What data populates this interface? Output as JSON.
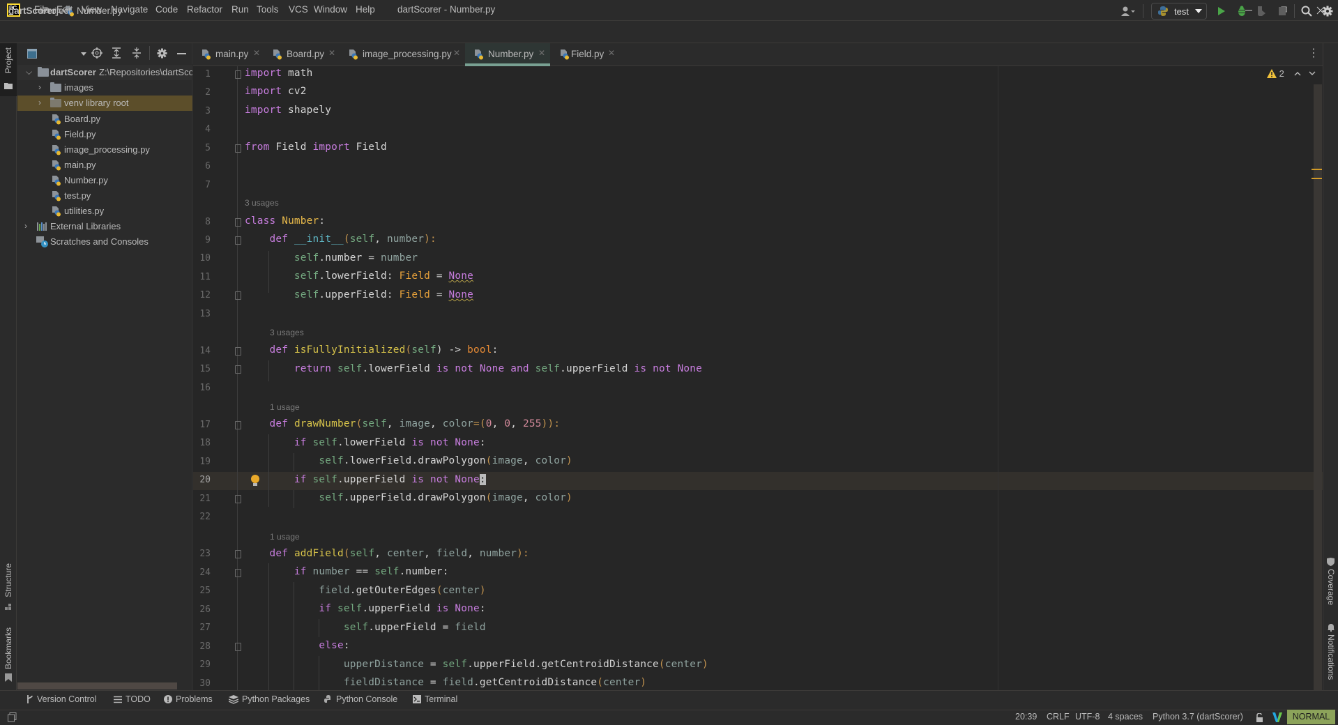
{
  "titlebar": {
    "logo_text": "PC",
    "menu": [
      "File",
      "Edit",
      "View",
      "Navigate",
      "Code",
      "Refactor",
      "Run",
      "Tools",
      "VCS",
      "Window",
      "Help"
    ],
    "window_title": "dartScorer - Number.py"
  },
  "navbar": {
    "breadcrumb_project": "dartScorer",
    "breadcrumb_file": "Number.py",
    "run_config": "test"
  },
  "left_strip": {
    "project": "Project",
    "structure": "Structure",
    "bookmarks": "Bookmarks"
  },
  "right_strip": {
    "coverage": "Coverage",
    "notifications": "Notifications"
  },
  "project_panel": {
    "title": "Project",
    "root_name": "dartScorer",
    "root_path": "Z:\\Repositories\\dartScorer",
    "items": [
      {
        "label": "images",
        "type": "folder"
      },
      {
        "label": "venv  library root",
        "type": "folder"
      },
      {
        "label": "Board.py",
        "type": "python"
      },
      {
        "label": "Field.py",
        "type": "python"
      },
      {
        "label": "image_processing.py",
        "type": "python"
      },
      {
        "label": "main.py",
        "type": "python"
      },
      {
        "label": "Number.py",
        "type": "python"
      },
      {
        "label": "test.py",
        "type": "python"
      },
      {
        "label": "utilities.py",
        "type": "python"
      }
    ],
    "external_libraries": "External Libraries",
    "scratches": "Scratches and Consoles"
  },
  "tabs": [
    {
      "label": "main.py",
      "active": false
    },
    {
      "label": "Board.py",
      "active": false
    },
    {
      "label": "image_processing.py",
      "active": false
    },
    {
      "label": "Number.py",
      "active": true
    },
    {
      "label": "Field.py",
      "active": false
    }
  ],
  "editor": {
    "warnings_count": "2",
    "usage_hints": [
      "3 usages",
      "3 usages",
      "1 usage",
      "1 usage"
    ],
    "line_numbers": [
      "1",
      "2",
      "3",
      "4",
      "5",
      "6",
      "7",
      "8",
      "9",
      "10",
      "11",
      "12",
      "13",
      "14",
      "15",
      "16",
      "17",
      "18",
      "19",
      "20",
      "21",
      "22",
      "23",
      "24",
      "25",
      "26",
      "27",
      "28",
      "29",
      "30"
    ],
    "current_line": "20",
    "lines": {
      "l1": [
        "import",
        " math"
      ],
      "l2": [
        "import",
        " cv2"
      ],
      "l3": [
        "import",
        " shapely"
      ],
      "l5": [
        "from",
        " Field ",
        "import",
        " Field"
      ],
      "l8": [
        "class",
        " ",
        "Number",
        ":"
      ],
      "l9": [
        "    ",
        "def",
        " ",
        "__init__",
        "(",
        "self",
        ", ",
        "number",
        "):"
      ],
      "l10": [
        "        ",
        "self",
        ".number = ",
        "number"
      ],
      "l11": [
        "        ",
        "self",
        ".lowerField: ",
        "Field",
        " = ",
        "None"
      ],
      "l12": [
        "        ",
        "self",
        ".upperField: ",
        "Field",
        " = ",
        "None"
      ],
      "l14": [
        "    ",
        "def",
        " ",
        "isFullyInitialized",
        "(",
        "self",
        ") -> ",
        "bool",
        ":"
      ],
      "l15": [
        "        ",
        "return",
        " ",
        "self",
        ".lowerField ",
        "is not None and",
        " ",
        "self",
        ".upperField ",
        "is not None"
      ],
      "l17": [
        "    ",
        "def",
        " ",
        "drawNumber",
        "(",
        "self",
        ", ",
        "image",
        ", ",
        "color",
        "=(",
        "0",
        ", ",
        "0",
        ", ",
        "255",
        ")):"
      ],
      "l18": [
        "        ",
        "if",
        " ",
        "self",
        ".lowerField ",
        "is not None",
        ":"
      ],
      "l19": [
        "            ",
        "self",
        ".lowerField.drawPolygon",
        "(",
        "image",
        ", ",
        "color",
        ")"
      ],
      "l20": [
        "        ",
        "if",
        " ",
        "self",
        ".upperField ",
        "is not None",
        ":"
      ],
      "l21": [
        "            ",
        "self",
        ".upperField.drawPolygon",
        "(",
        "image",
        ", ",
        "color",
        ")"
      ],
      "l23": [
        "    ",
        "def",
        " ",
        "addField",
        "(",
        "self",
        ", ",
        "center",
        ", ",
        "field",
        ", ",
        "number",
        "):"
      ],
      "l24": [
        "        ",
        "if",
        " ",
        "number",
        " == ",
        "self",
        ".number:"
      ],
      "l25": [
        "            ",
        "field",
        ".getOuterEdges",
        "(",
        "center",
        ")"
      ],
      "l26": [
        "            ",
        "if",
        " ",
        "self",
        ".upperField ",
        "is None",
        ":"
      ],
      "l27": [
        "                ",
        "self",
        ".upperField = ",
        "field"
      ],
      "l28": [
        "            ",
        "else",
        ":"
      ],
      "l29": [
        "                ",
        "upperDistance",
        " = ",
        "self",
        ".upperField.getCentroidDistance",
        "(",
        "center",
        ")"
      ],
      "l30": [
        "                ",
        "fieldDistance",
        " = ",
        "field",
        ".getCentroidDistance",
        "(",
        "center",
        ")"
      ]
    }
  },
  "bottom_tools": [
    "Version Control",
    "TODO",
    "Problems",
    "Python Packages",
    "Python Console",
    "Terminal"
  ],
  "statusbar": {
    "position": "20:39",
    "line_separator": "CRLF",
    "encoding": "UTF-8",
    "indent": "4 spaces",
    "interpreter": "Python 3.7 (dartScorer)",
    "vim_mode": "NORMAL"
  },
  "colors": {
    "background": "#2b2b2b",
    "editor_bg": "#262626",
    "keyword": "#c77dde",
    "function": "#d7c34a",
    "self": "#74a980",
    "active_tab_underline": "#78a092",
    "selected_tree_row": "#5c4e2a",
    "vim_mode_bg": "#8ca35a"
  }
}
